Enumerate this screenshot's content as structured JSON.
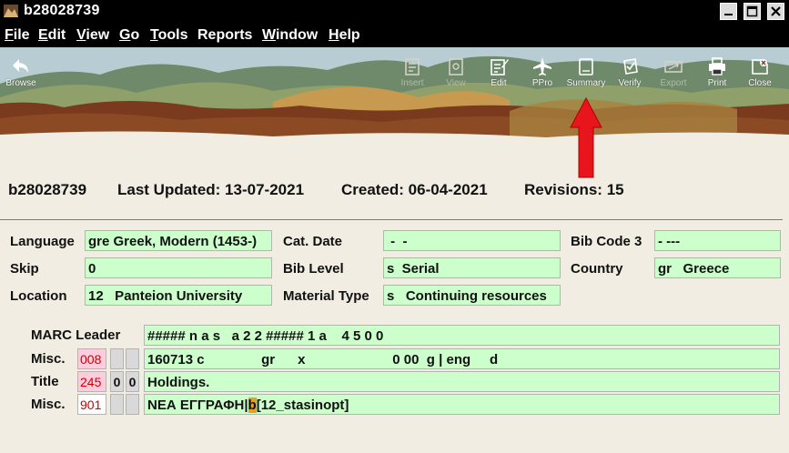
{
  "window": {
    "title": "b28028739"
  },
  "menu": [
    {
      "label": "File",
      "acc": "F",
      "rest": "ile"
    },
    {
      "label": "Edit",
      "acc": "E",
      "rest": "dit"
    },
    {
      "label": "View",
      "acc": "V",
      "rest": "iew"
    },
    {
      "label": "Go",
      "acc": "G",
      "rest": "o"
    },
    {
      "label": "Tools",
      "acc": "T",
      "rest": "ools"
    },
    {
      "label": "Reports",
      "acc": "",
      "rest": "Reports"
    },
    {
      "label": "Window",
      "acc": "W",
      "rest": "indow"
    },
    {
      "label": "Help",
      "acc": "H",
      "rest": "elp"
    }
  ],
  "toolbar": {
    "browse": "Browse",
    "insert": "Insert",
    "view": "View",
    "edit": "Edit",
    "ppro": "PPro",
    "summary": "Summary",
    "verify": "Verify",
    "export": "Export",
    "print": "Print",
    "close": "Close"
  },
  "record": {
    "id": "b28028739",
    "last_updated": "Last Updated: 13-07-2021",
    "created": "Created: 06-04-2021",
    "revisions": "Revisions: 15"
  },
  "fixed_fields": {
    "language_label": "Language",
    "language_value": "gre Greek, Modern (1453-)",
    "skip_label": "Skip",
    "skip_value": "0",
    "location_label": "Location",
    "location_value": "12   Panteion University",
    "cat_date_label": "Cat. Date",
    "cat_date_value": " -  -",
    "bib_level_label": "Bib Level",
    "bib_level_value": "s  Serial",
    "material_type_label": "Material Type",
    "material_type_value": "s   Continuing resources",
    "bib_code3_label": "Bib Code 3",
    "bib_code3_value": "- ---",
    "country_label": "Country",
    "country_value": "gr   Greece"
  },
  "marc": {
    "leader_label": "MARC Leader",
    "leader_value": "##### n a s   a 2 2 ##### 1 a    4 5 0 0",
    "rows": [
      {
        "label": "Misc.",
        "tag": "008",
        "ind1": "",
        "ind2": "",
        "value": "160713 c               gr      x                       0 00  g | eng     d"
      },
      {
        "label": "Title",
        "tag": "245",
        "ind1": "0",
        "ind2": "0",
        "value": "Holdings."
      },
      {
        "label": "Misc.",
        "tag": "901",
        "ind1": "",
        "ind2": "",
        "value_pre": "ΝΕΑ ΕΓΓΡΑΦΗ|",
        "value_hl": "b",
        "value_post": "[12_stasinopt]"
      }
    ]
  },
  "colors": {
    "field_bg": "#ccffcc",
    "tag_bg": "#ffccdd",
    "tag_text": "#cc0000",
    "arrow": "#e8161c",
    "subfield_highlight": "#e8a020"
  },
  "icons": {
    "app": "mountain-app-icon",
    "browse": "back-arrow-icon",
    "insert": "insert-icon",
    "view": "view-icon",
    "edit": "edit-document-icon",
    "ppro": "airplane-icon",
    "summary": "summary-document-icon",
    "verify": "verify-icon",
    "export": "export-icon",
    "print": "printer-icon",
    "close": "close-document-icon"
  }
}
